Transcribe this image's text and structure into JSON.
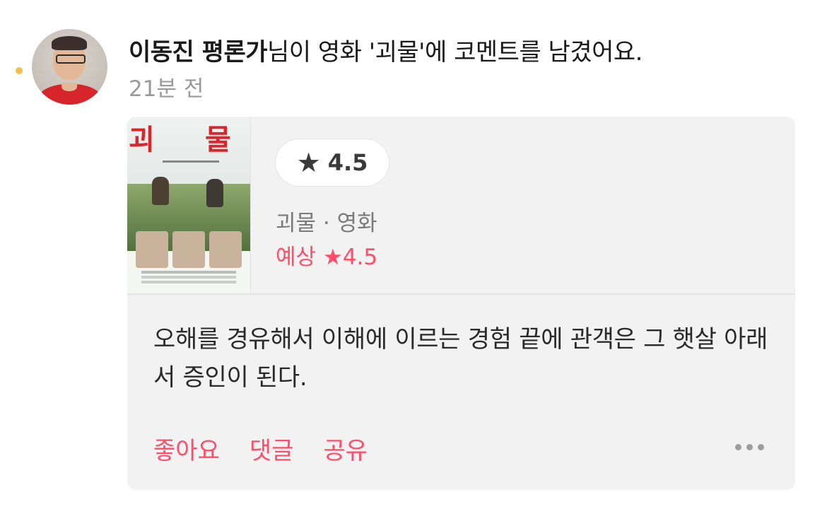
{
  "feed_item": {
    "user_name": "이동진 평론가",
    "action_text": "님이 영화 '괴물'에 코멘트를 남겼어요.",
    "time_ago": "21분 전"
  },
  "movie": {
    "poster_title_char1": "괴",
    "poster_title_char2": "물",
    "rating_star": "★",
    "rating_value": "4.5",
    "meta": "괴물 · 영화",
    "expected_label": "예상",
    "expected_rating": "★4.5"
  },
  "comment": {
    "text": "오해를 경유해서 이해에 이르는 경험 끝에 관객은 그 햇살 아래서 증인이 된다."
  },
  "actions": {
    "like": "좋아요",
    "comment": "댓글",
    "share": "공유",
    "more_icon": "ellipsis-icon"
  },
  "colors": {
    "accent": "#ff4d6a",
    "unread_dot": "#f5c04a",
    "card_bg": "#f2f2f2"
  }
}
